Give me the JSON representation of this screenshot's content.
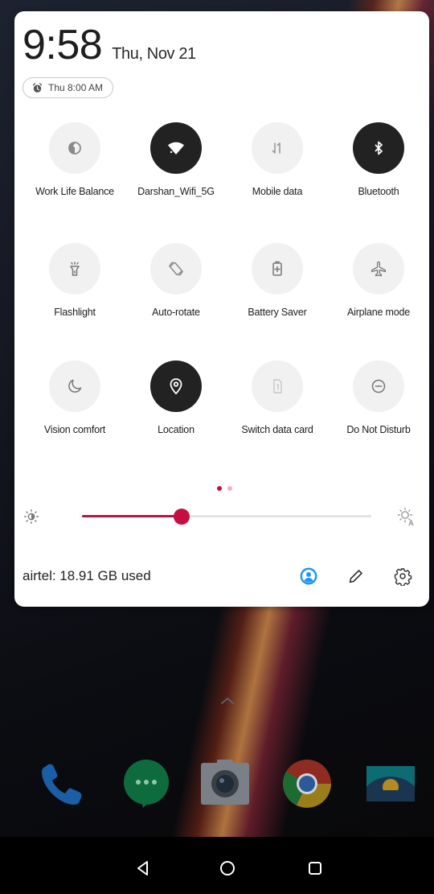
{
  "status": {
    "time": "9:58",
    "date": "Thu, Nov 21",
    "alarm": "Thu 8:00 AM"
  },
  "tiles": [
    {
      "label": "Work Life Balance",
      "icon": "work-life-balance-icon",
      "active": false
    },
    {
      "label": "Darshan_Wifi_5G",
      "icon": "wifi-icon",
      "active": true
    },
    {
      "label": "Mobile data",
      "icon": "mobile-data-icon",
      "active": false
    },
    {
      "label": "Bluetooth",
      "icon": "bluetooth-icon",
      "active": true
    },
    {
      "label": "Flashlight",
      "icon": "flashlight-icon",
      "active": false
    },
    {
      "label": "Auto-rotate",
      "icon": "auto-rotate-icon",
      "active": false
    },
    {
      "label": "Battery Saver",
      "icon": "battery-saver-icon",
      "active": false
    },
    {
      "label": "Airplane mode",
      "icon": "airplane-icon",
      "active": false
    },
    {
      "label": "Vision comfort",
      "icon": "moon-icon",
      "active": false
    },
    {
      "label": "Location",
      "icon": "location-pin-icon",
      "active": true
    },
    {
      "label": "Switch data card",
      "icon": "sim-card-icon",
      "active": false
    },
    {
      "label": "Do Not Disturb",
      "icon": "do-not-disturb-icon",
      "active": false
    }
  ],
  "pages": {
    "count": 2,
    "current": 1
  },
  "brightness": {
    "level": 0.345
  },
  "footer": {
    "data_usage": "airtel: 18.91 GB used",
    "icons": [
      "user-account-icon",
      "edit-pencil-icon",
      "settings-gear-icon"
    ]
  },
  "dock": [
    "phone-icon",
    "hangouts-icon",
    "camera-icon",
    "chrome-icon",
    "gallery-icon"
  ],
  "navigation": [
    "back-icon",
    "home-icon",
    "recents-icon"
  ],
  "colors": {
    "accent": "#c5103f",
    "tile_active": "#222222",
    "tile_inactive": "#f1f1f1",
    "account_icon": "#2196f3"
  }
}
